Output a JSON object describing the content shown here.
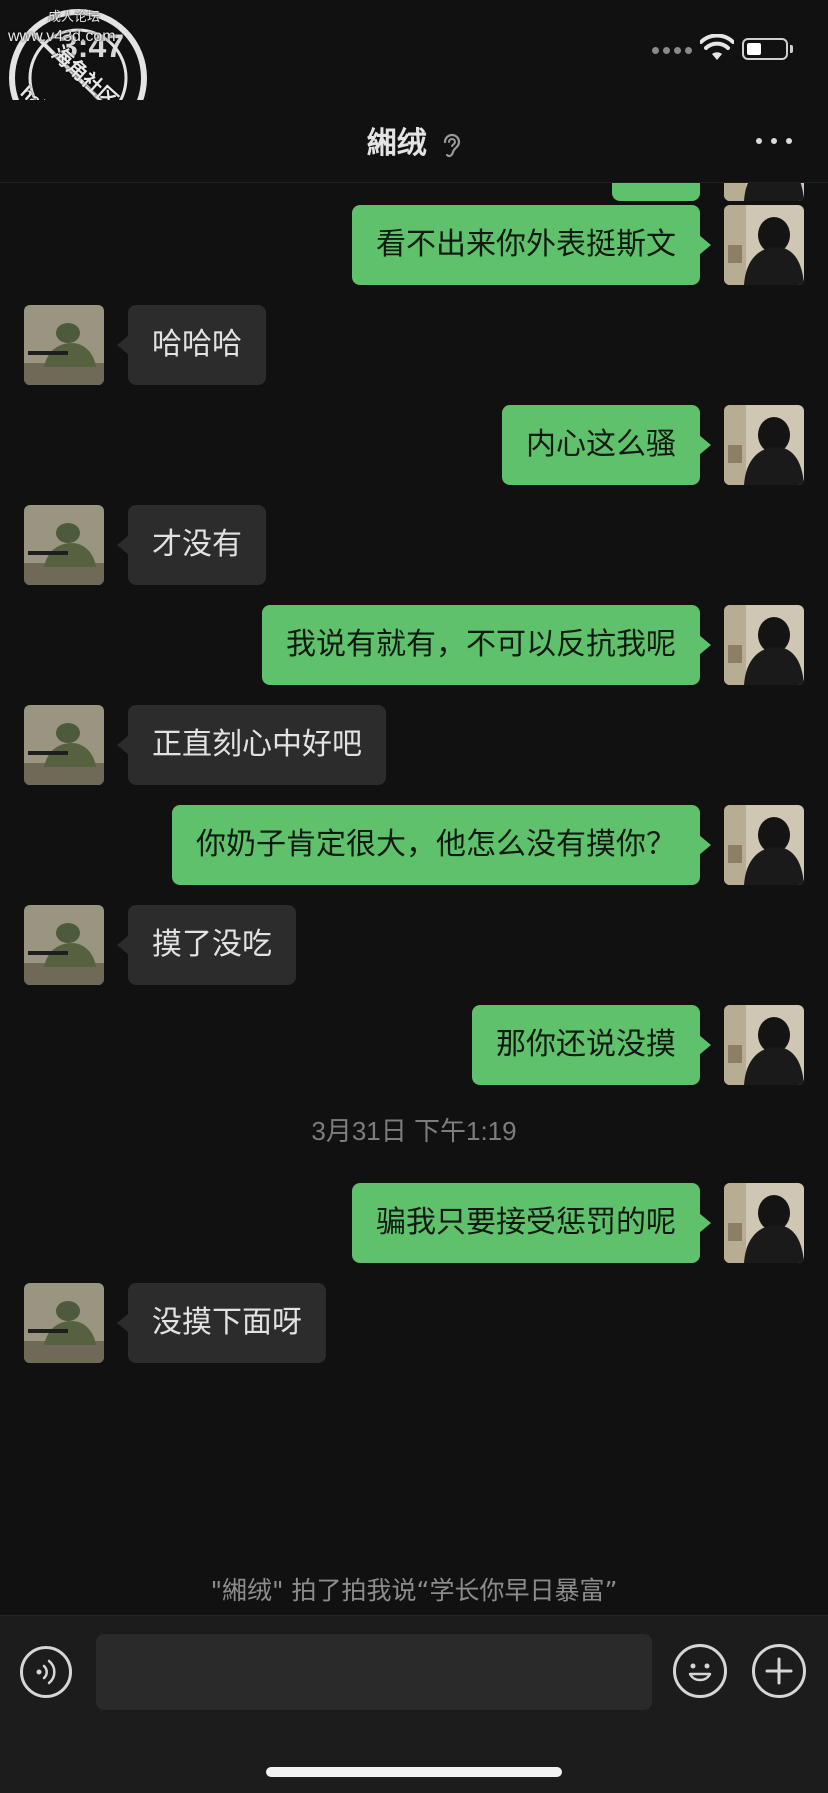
{
  "status_bar": {
    "time": "3:47"
  },
  "watermark": {
    "top_text": "成人论坛",
    "url_text": "www.v43d.com",
    "site_text": "haijiao.com",
    "cn_text": "海角社区"
  },
  "header": {
    "title": "緗绒"
  },
  "messages": [
    {
      "side": "out",
      "text": "看不出来你外表挺斯文"
    },
    {
      "side": "in",
      "text": "哈哈哈"
    },
    {
      "side": "out",
      "text": "内心这么骚"
    },
    {
      "side": "in",
      "text": "才没有"
    },
    {
      "side": "out",
      "text": "我说有就有，不可以反抗我呢"
    },
    {
      "side": "in",
      "text": "正直刻心中好吧"
    },
    {
      "side": "out",
      "text": "你奶子肯定很大，他怎么没有摸你？"
    },
    {
      "side": "in",
      "text": "摸了没吃"
    },
    {
      "side": "out",
      "text": "那你还说没摸"
    },
    {
      "side": "out",
      "text": "骗我只要接受惩罚的呢"
    },
    {
      "side": "in",
      "text": "没摸下面呀"
    }
  ],
  "timestamp": "3月31日 下午1:19",
  "pat_notice": "\"緗绒\" 拍了拍我说“学长你早日暴富”",
  "input_bar": {
    "placeholder": ""
  },
  "colors": {
    "outgoing_bubble": "#5fc16c",
    "incoming_bubble": "#2c2c2c",
    "background": "#111111"
  }
}
